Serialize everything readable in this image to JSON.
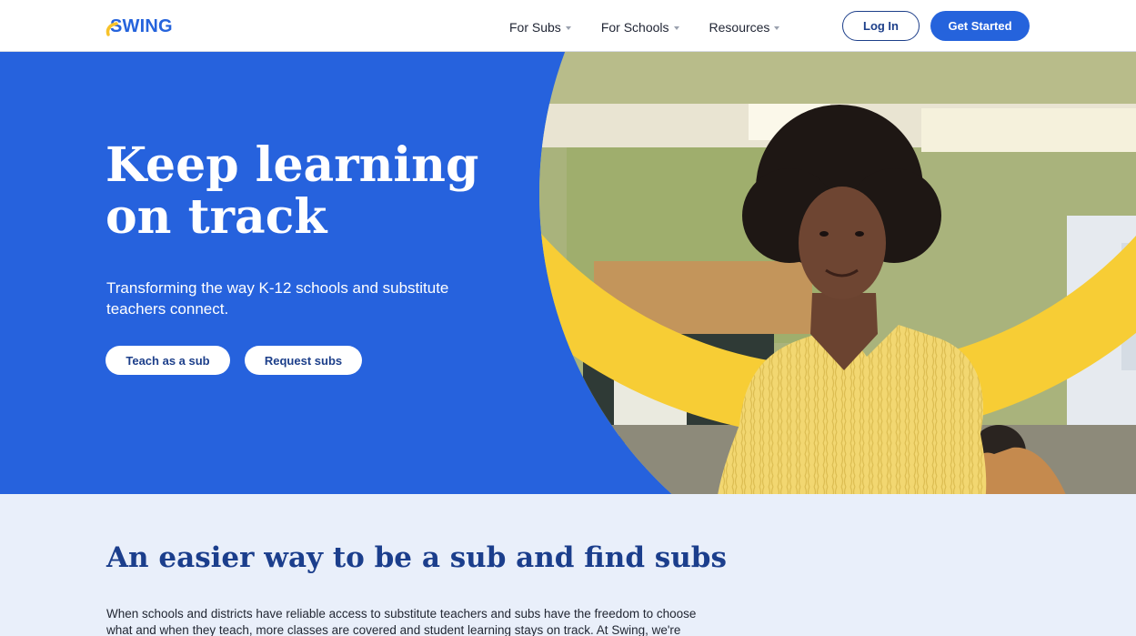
{
  "brand": {
    "logo_text": "SWING",
    "accent": "#2563dc",
    "yellow": "#f7cd35",
    "navy": "#1b3e8c"
  },
  "nav": {
    "items": [
      {
        "label": "For Subs",
        "icon": "chevron-down-icon"
      },
      {
        "label": "For Schools",
        "icon": "chevron-down-icon"
      },
      {
        "label": "Resources",
        "icon": "chevron-down-icon"
      }
    ],
    "login_label": "Log In",
    "get_started_label": "Get Started"
  },
  "hero": {
    "title_line1": "Keep learning",
    "title_line2": "on track",
    "subtitle": "Transforming the way K-12 schools and substitute teachers connect.",
    "teach_button": "Teach as a sub",
    "request_button": "Request subs"
  },
  "section": {
    "title": "An easier way to be a sub and find subs",
    "body": "When schools and districts have reliable access to substitute teachers and subs have the freedom to choose what and when they teach, more classes are covered and student learning stays on track. At Swing, we're"
  }
}
